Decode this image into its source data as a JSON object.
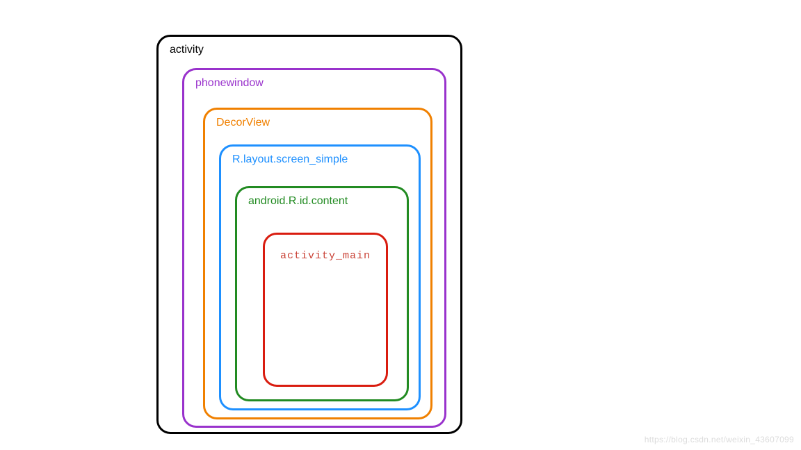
{
  "layers": {
    "activity": {
      "label": "activity",
      "color": "#000000"
    },
    "phonewindow": {
      "label": "phonewindow",
      "color": "#9932cc"
    },
    "decorview": {
      "label": "DecorView",
      "color": "#f08000"
    },
    "screensimple": {
      "label": "R.layout.screen_simple",
      "color": "#1e90ff"
    },
    "content": {
      "label": "android.R.id.content",
      "color": "#228b22"
    },
    "activitymain": {
      "label": "activity_main",
      "color": "#d91c0f"
    }
  },
  "watermark": "https://blog.csdn.net/weixin_43607099"
}
